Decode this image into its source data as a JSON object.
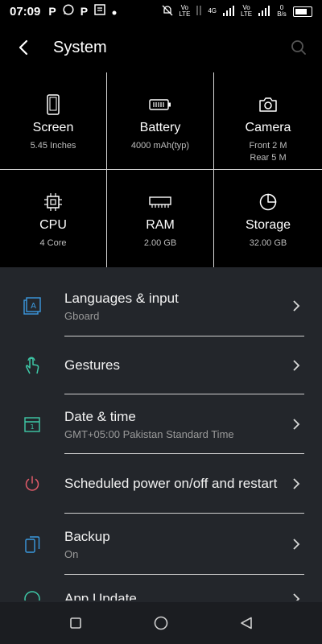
{
  "status_bar": {
    "time": "07:09",
    "notif_letters": [
      "P",
      "P"
    ],
    "net_labels": [
      "Vo LTE",
      "4G",
      "Vo LTE"
    ],
    "data_rate": "0 B/s"
  },
  "header": {
    "title": "System"
  },
  "specs": [
    {
      "name": "Screen",
      "value": "5.45 Inches",
      "value2": ""
    },
    {
      "name": "Battery",
      "value": "4000 mAh(typ)",
      "value2": ""
    },
    {
      "name": "Camera",
      "value": "Front 2 M",
      "value2": "Rear 5 M"
    },
    {
      "name": "CPU",
      "value": "4 Core",
      "value2": ""
    },
    {
      "name": "RAM",
      "value": "2.00 GB",
      "value2": ""
    },
    {
      "name": "Storage",
      "value": "32.00 GB",
      "value2": ""
    }
  ],
  "settings": [
    {
      "title": "Languages & input",
      "subtitle": "Gboard",
      "icon_color": "#3b9ae0"
    },
    {
      "title": "Gestures",
      "subtitle": "",
      "icon_color": "#3ec9a8"
    },
    {
      "title": "Date & time",
      "subtitle": "GMT+05:00 Pakistan Standard Time",
      "icon_color": "#3ec9a8"
    },
    {
      "title": "Scheduled power on/off and restart",
      "subtitle": "",
      "icon_color": "#e35b6a"
    },
    {
      "title": "Backup",
      "subtitle": "On",
      "icon_color": "#3b9ae0"
    },
    {
      "title": "App Update",
      "subtitle": "",
      "icon_color": "#3ec9a8"
    }
  ],
  "colors": {
    "background": "#23262b",
    "panel": "#000000",
    "accent_blue": "#3b9ae0",
    "accent_teal": "#3ec9a8",
    "accent_red": "#e35b6a"
  }
}
